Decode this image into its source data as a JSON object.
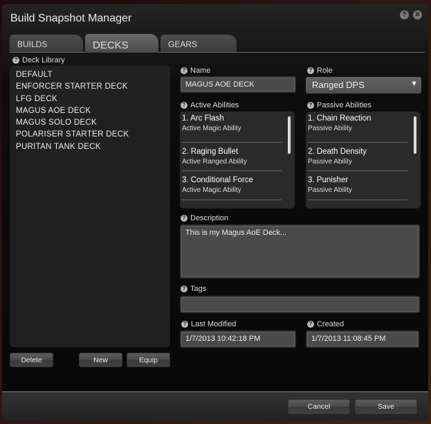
{
  "window": {
    "title": "Build Snapshot Manager",
    "help_icon": "?",
    "close_icon": "✕"
  },
  "tabs": [
    {
      "label": "BUILDS",
      "active": false
    },
    {
      "label": "DECKS",
      "active": true
    },
    {
      "label": "GEARS",
      "active": false
    }
  ],
  "library": {
    "label": "Deck Library",
    "items": [
      "DEFAULT",
      "ENFORCER STARTER DECK",
      "LFG DECK",
      "MAGUS AOE DECK",
      "MAGUS SOLO DECK",
      "POLARISER STARTER DECK",
      "PURITAN TANK DECK"
    ],
    "buttons": {
      "delete": "Delete",
      "new": "New",
      "equip": "Equip"
    }
  },
  "form": {
    "name_label": "Name",
    "name_value": "MAGUS AOE DECK",
    "role_label": "Role",
    "role_value": "Ranged DPS",
    "active_label": "Active Abilities",
    "active_abilities": [
      {
        "name": "1. Arc Flash",
        "type": "Active Magic Ability"
      },
      {
        "name": "2. Raging Bullet",
        "type": "Active Ranged Ability"
      },
      {
        "name": "3. Conditional Force",
        "type": "Active Magic Ability"
      }
    ],
    "passive_label": "Passive Abilities",
    "passive_abilities": [
      {
        "name": "1. Chain Reaction",
        "type": "Passive Ability"
      },
      {
        "name": "2. Death Density",
        "type": "Passive Ability"
      },
      {
        "name": "3. Punisher",
        "type": "Passive Ability"
      }
    ],
    "description_label": "Description",
    "description_value": "This is my Magus AoE Deck...",
    "tags_label": "Tags",
    "tags_value": "",
    "last_modified_label": "Last Modified",
    "last_modified_value": "1/7/2013 10:42:18 PM",
    "created_label": "Created",
    "created_value": "1/7/2013 11:08:45 PM"
  },
  "footer": {
    "cancel": "Cancel",
    "save": "Save"
  }
}
